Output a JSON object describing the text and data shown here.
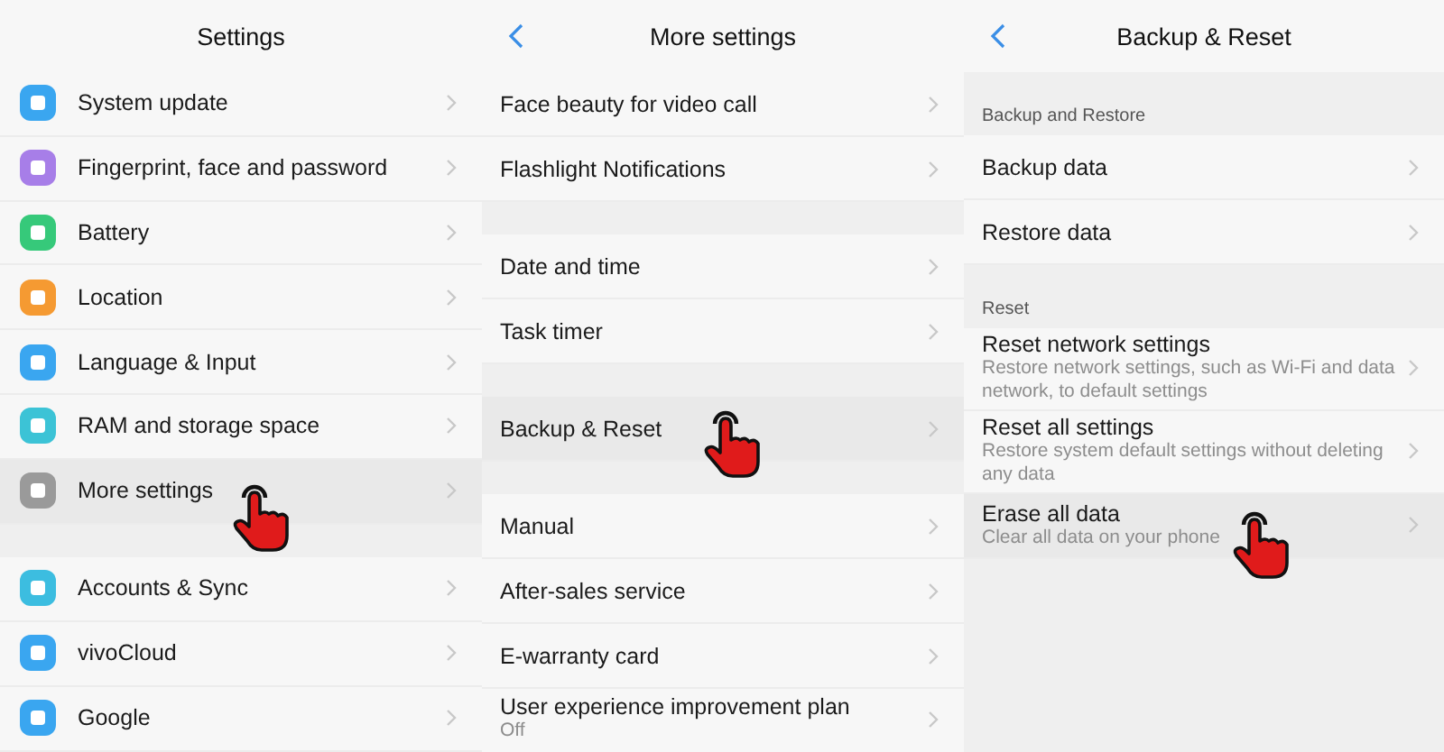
{
  "panels": [
    {
      "title": "Settings",
      "back": false,
      "groups": [
        {
          "items": [
            {
              "label": "System update",
              "color": "#3aa6f0",
              "selected": false
            },
            {
              "label": "Fingerprint, face and password",
              "color": "#a77ee8",
              "selected": false
            },
            {
              "label": "Battery",
              "color": "#36c97a",
              "selected": false
            },
            {
              "label": "Location",
              "color": "#f59a32",
              "selected": false
            },
            {
              "label": "Language & Input",
              "color": "#3aa6f0",
              "selected": false
            },
            {
              "label": "RAM and storage space",
              "color": "#3cc3d6",
              "selected": false
            },
            {
              "label": "More settings",
              "color": "#9a9a9a",
              "selected": true
            }
          ]
        },
        {
          "items": [
            {
              "label": "Accounts & Sync",
              "color": "#3cbde0",
              "selected": false
            },
            {
              "label": "vivoCloud",
              "color": "#3aa6f0",
              "selected": false
            },
            {
              "label": "Google",
              "color": "#3aa6f0",
              "selected": false
            }
          ]
        }
      ]
    },
    {
      "title": "More settings",
      "back": true,
      "groups": [
        {
          "items": [
            {
              "label": "Face beauty for video call",
              "selected": false
            },
            {
              "label": "Flashlight Notifications",
              "selected": false
            }
          ]
        },
        {
          "items": [
            {
              "label": "Date and time",
              "selected": false
            },
            {
              "label": "Task timer",
              "selected": false
            }
          ]
        },
        {
          "items": [
            {
              "label": "Backup & Reset",
              "selected": true
            }
          ]
        },
        {
          "items": [
            {
              "label": "Manual",
              "selected": false
            },
            {
              "label": "After-sales service",
              "selected": false
            },
            {
              "label": "E-warranty card",
              "selected": false
            },
            {
              "label": "User experience improvement plan",
              "sub": "Off",
              "selected": false
            }
          ]
        }
      ]
    },
    {
      "title": "Backup & Reset",
      "back": true,
      "groups": [
        {
          "header": "Backup and Restore",
          "items": [
            {
              "label": "Backup data",
              "selected": false
            },
            {
              "label": "Restore data",
              "selected": false
            }
          ]
        },
        {
          "header": "Reset",
          "items": [
            {
              "label": "Reset network settings",
              "sub": "Restore network settings, such as Wi-Fi and data network, to default settings",
              "selected": false
            },
            {
              "label": "Reset all settings",
              "sub": "Restore system default settings without deleting any data",
              "selected": false
            },
            {
              "label": "Erase all data",
              "sub": "Clear all data on your phone",
              "selected": true
            }
          ]
        }
      ]
    }
  ]
}
